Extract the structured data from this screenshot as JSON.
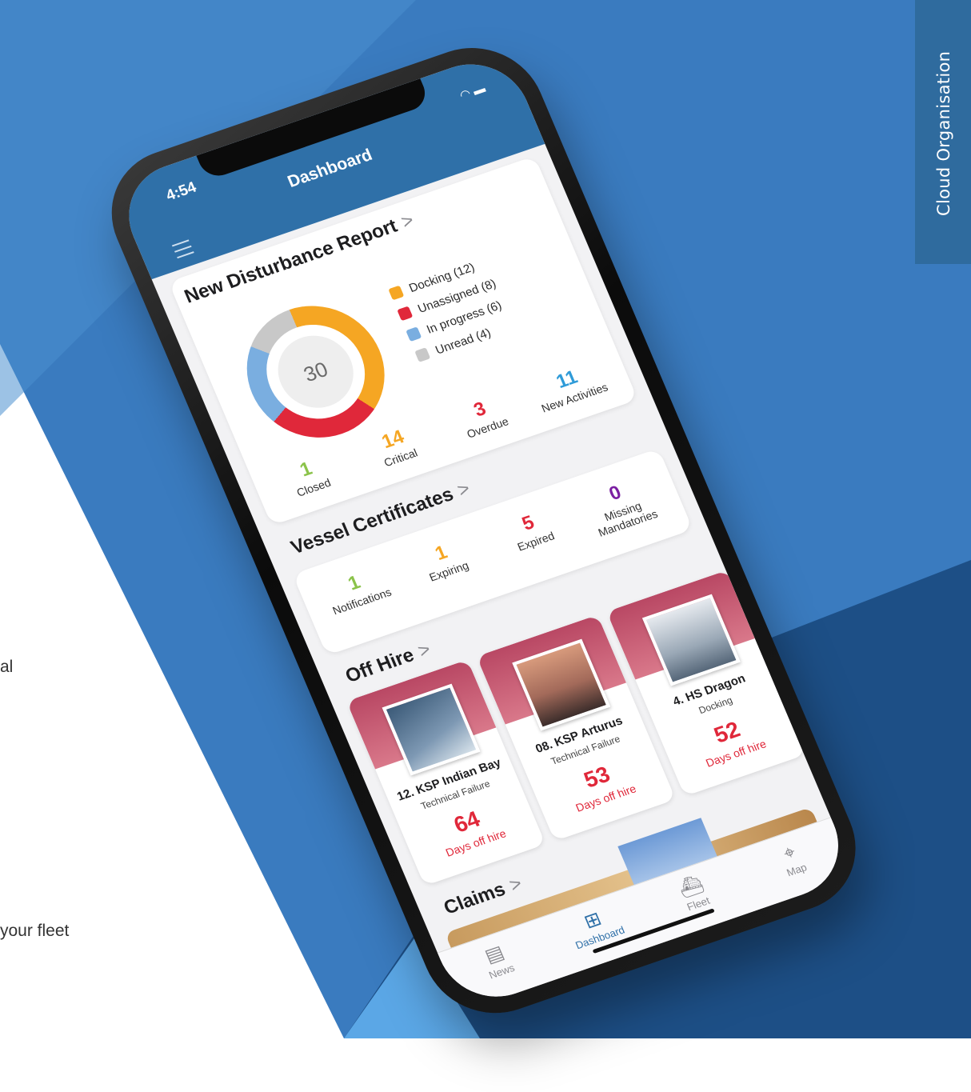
{
  "side_tab": {
    "text": "Cloud Organisation"
  },
  "left_text": {
    "line1_fragment": "al",
    "line2_fragment": "your fleet"
  },
  "colors": {
    "primary": "#2f70a8",
    "docking": "#f5a623",
    "unassigned": "#e0283a",
    "in_progress": "#7aaee0",
    "unread": "#c8c8c8",
    "green": "#8bc34a",
    "orange": "#f5a623",
    "red": "#e0283a",
    "purple": "#7b1fa2",
    "blue": "#2f9bd8"
  },
  "app": {
    "time": "4:54",
    "status_icons": "wifi-icon battery-icon",
    "title": "Dashboard",
    "disturbance": {
      "title": "New Disturbance Report",
      "chevron": ">",
      "total": "30",
      "chart_data": {
        "type": "pie",
        "categories": [
          "Docking",
          "Unassigned",
          "In progress",
          "Unread"
        ],
        "values": [
          12,
          8,
          6,
          4
        ]
      },
      "legend": [
        {
          "label": "Docking (12)",
          "color": "#f5a623"
        },
        {
          "label": "Unassigned (8)",
          "color": "#e0283a"
        },
        {
          "label": "In progress (6)",
          "color": "#7aaee0"
        },
        {
          "label": "Unread (4)",
          "color": "#c8c8c8"
        }
      ],
      "stats": [
        {
          "num": "1",
          "label": "Closed"
        },
        {
          "num": "14",
          "label": "Critical"
        },
        {
          "num": "3",
          "label": "Overdue"
        },
        {
          "num": "11",
          "label": "New Activities"
        }
      ]
    },
    "certificates": {
      "title": "Vessel Certificates",
      "chevron": ">",
      "stats": [
        {
          "num": "1",
          "label": "Notifications"
        },
        {
          "num": "1",
          "label": "Expiring"
        },
        {
          "num": "5",
          "label": "Expired"
        },
        {
          "num": "0",
          "label": "Missing Mandatories"
        }
      ]
    },
    "off_hire": {
      "title": "Off Hire",
      "chevron": ">",
      "cards": [
        {
          "name": "12. KSP Indian Bay",
          "reason": "Technical Failure",
          "days": "64",
          "days_label": "Days off hire"
        },
        {
          "name": "08. KSP Arturus",
          "reason": "Technical Failure",
          "days": "53",
          "days_label": "Days off hire"
        },
        {
          "name": "4. HS Dragon",
          "reason": "Docking",
          "days": "52",
          "days_label": "Days off hire"
        }
      ]
    },
    "claims": {
      "title": "Claims",
      "chevron": ">"
    },
    "tabs": [
      {
        "label": "News",
        "icon": "newspaper-icon"
      },
      {
        "label": "Dashboard",
        "icon": "dashboard-grid-icon"
      },
      {
        "label": "Fleet",
        "icon": "ship-icon"
      },
      {
        "label": "Map",
        "icon": "map-pin-icon"
      }
    ]
  }
}
